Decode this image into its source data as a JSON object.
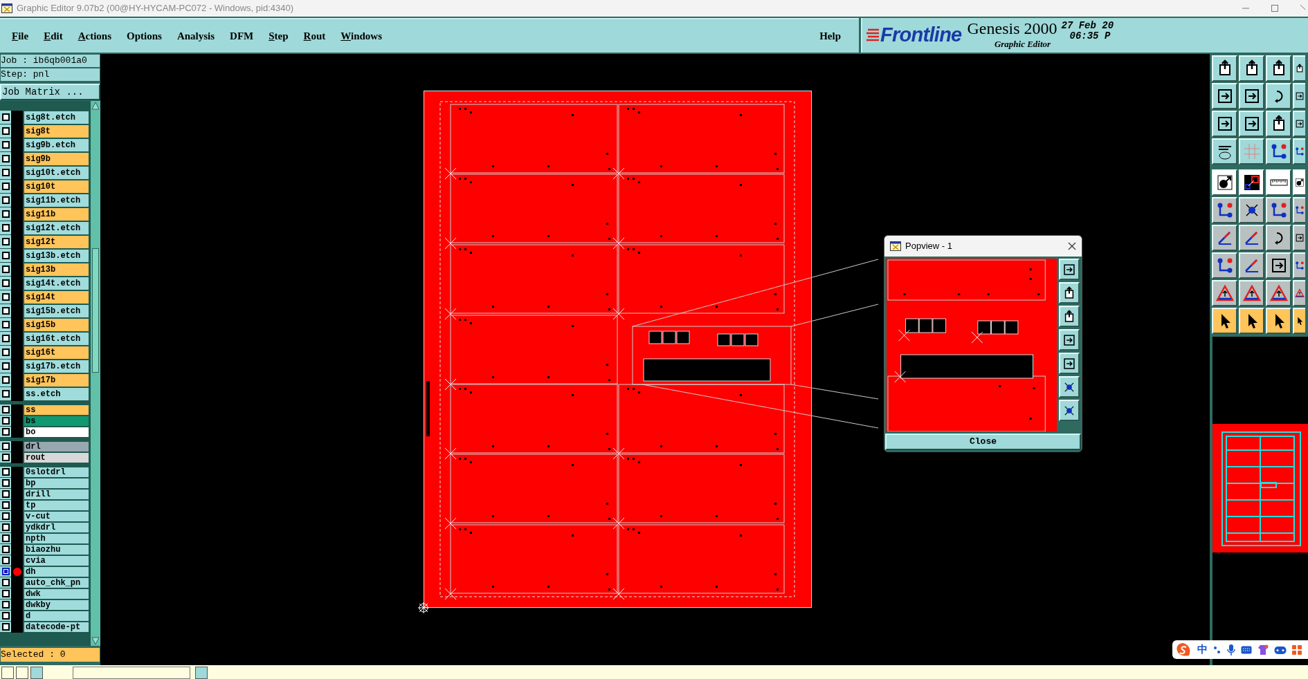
{
  "window": {
    "title": "Graphic Editor 9.07b2 (00@HY-HYCAM-PC072 - Windows, pid:4340)"
  },
  "menu": [
    {
      "label": "File",
      "mnemonic": true
    },
    {
      "label": "Edit",
      "mnemonic": true
    },
    {
      "label": "Actions",
      "mnemonic": true
    },
    {
      "label": "Options",
      "mnemonic": false
    },
    {
      "label": "Analysis",
      "mnemonic": false
    },
    {
      "label": "DFM",
      "mnemonic": false
    },
    {
      "label": "Step",
      "mnemonic": true
    },
    {
      "label": "Rout",
      "mnemonic": true
    },
    {
      "label": "Windows",
      "mnemonic": true
    }
  ],
  "help": "Help",
  "brand": {
    "logo": "Frontline",
    "product": "Genesis 2000",
    "subtitle": "Graphic Editor",
    "date": "27 Feb 20",
    "time": "06:35 P"
  },
  "job": "Job : ib6qb001a0",
  "step": "Step: pnl",
  "job_matrix_button": "Job Matrix ...",
  "layer_groups": [
    {
      "layers": [
        {
          "name": "sig8t.etch",
          "color": "#a0dcdc",
          "selected": false,
          "flagged": false
        },
        {
          "name": "sig8t",
          "color": "#ffc45a",
          "selected": false,
          "flagged": false
        },
        {
          "name": "sig9b.etch",
          "color": "#a0dcdc",
          "selected": false,
          "flagged": false
        },
        {
          "name": "sig9b",
          "color": "#ffc45a",
          "selected": false,
          "flagged": false
        },
        {
          "name": "sig10t.etch",
          "color": "#a0dcdc",
          "selected": false,
          "flagged": false
        },
        {
          "name": "sig10t",
          "color": "#ffc45a",
          "selected": false,
          "flagged": false
        },
        {
          "name": "sig11b.etch",
          "color": "#a0dcdc",
          "selected": false,
          "flagged": false
        },
        {
          "name": "sig11b",
          "color": "#ffc45a",
          "selected": false,
          "flagged": false
        },
        {
          "name": "sig12t.etch",
          "color": "#a0dcdc",
          "selected": false,
          "flagged": false
        },
        {
          "name": "sig12t",
          "color": "#ffc45a",
          "selected": false,
          "flagged": false
        },
        {
          "name": "sig13b.etch",
          "color": "#a0dcdc",
          "selected": false,
          "flagged": false
        },
        {
          "name": "sig13b",
          "color": "#ffc45a",
          "selected": false,
          "flagged": false
        },
        {
          "name": "sig14t.etch",
          "color": "#a0dcdc",
          "selected": false,
          "flagged": false
        },
        {
          "name": "sig14t",
          "color": "#ffc45a",
          "selected": false,
          "flagged": false
        },
        {
          "name": "sig15b.etch",
          "color": "#a0dcdc",
          "selected": false,
          "flagged": false
        },
        {
          "name": "sig15b",
          "color": "#ffc45a",
          "selected": false,
          "flagged": false
        },
        {
          "name": "sig16t.etch",
          "color": "#a0dcdc",
          "selected": false,
          "flagged": false
        },
        {
          "name": "sig16t",
          "color": "#ffc45a",
          "selected": false,
          "flagged": false
        },
        {
          "name": "sig17b.etch",
          "color": "#a0dcdc",
          "selected": false,
          "flagged": false
        },
        {
          "name": "sig17b",
          "color": "#ffc45a",
          "selected": false,
          "flagged": false
        },
        {
          "name": "ss.etch",
          "color": "#a0dcdc",
          "selected": false,
          "flagged": false
        }
      ]
    },
    {
      "layers": [
        {
          "name": "ss",
          "color": "#ffc45a",
          "selected": false,
          "flagged": false
        },
        {
          "name": "bs",
          "color": "#109870",
          "selected": false,
          "flagged": false
        },
        {
          "name": "bo",
          "color": "#ffffff",
          "selected": false,
          "flagged": false
        }
      ]
    },
    {
      "layers": [
        {
          "name": "drl",
          "color": "#98a8b0",
          "selected": false,
          "flagged": false
        },
        {
          "name": "rout",
          "color": "#d8d8d8",
          "selected": false,
          "flagged": false
        }
      ]
    },
    {
      "layers": [
        {
          "name": "0slotdrl",
          "color": "#a0dcdc",
          "selected": false,
          "flagged": false
        },
        {
          "name": "bp",
          "color": "#a0dcdc",
          "selected": false,
          "flagged": false
        },
        {
          "name": "drill",
          "color": "#a0dcdc",
          "selected": false,
          "flagged": false
        },
        {
          "name": "tp",
          "color": "#a0dcdc",
          "selected": false,
          "flagged": false
        },
        {
          "name": "v-cut",
          "color": "#a0dcdc",
          "selected": false,
          "flagged": false
        },
        {
          "name": "ydkdrl",
          "color": "#a0dcdc",
          "selected": false,
          "flagged": false
        },
        {
          "name": "npth",
          "color": "#a0dcdc",
          "selected": false,
          "flagged": false
        },
        {
          "name": "biaozhu",
          "color": "#a0dcdc",
          "selected": false,
          "flagged": false
        },
        {
          "name": "cvia",
          "color": "#a0dcdc",
          "selected": false,
          "flagged": false
        },
        {
          "name": "dh",
          "color": "#a0dcdc",
          "selected": true,
          "flagged": true
        },
        {
          "name": "auto_chk_pn",
          "color": "#a0dcdc",
          "selected": false,
          "flagged": false
        },
        {
          "name": "dwk",
          "color": "#a0dcdc",
          "selected": false,
          "flagged": false
        },
        {
          "name": "dwkby",
          "color": "#a0dcdc",
          "selected": false,
          "flagged": false
        },
        {
          "name": "d",
          "color": "#a0dcdc",
          "selected": false,
          "flagged": false
        },
        {
          "name": "datecode-pt",
          "color": "#a0dcdc",
          "selected": false,
          "flagged": false
        }
      ]
    }
  ],
  "selected_count": "Selected : 0",
  "popview": {
    "title": "Popview - 1",
    "close_button": "Close"
  },
  "ime_bar": {
    "language": "中"
  }
}
